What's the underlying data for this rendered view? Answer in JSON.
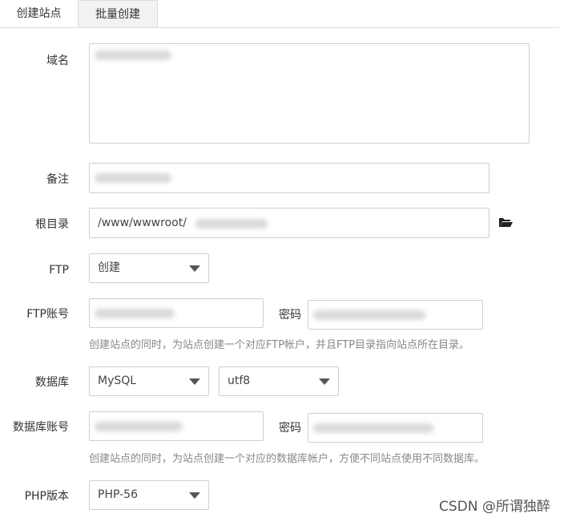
{
  "tabs": [
    {
      "label": "创建站点"
    },
    {
      "label": "批量创建"
    }
  ],
  "fields": {
    "domain_label": "域名",
    "remark_label": "备注",
    "root_label": "根目录",
    "root_value": "/www/wwwroot/",
    "ftp_label": "FTP",
    "ftp_select": "创建",
    "ftp_account_label": "FTP账号",
    "ftp_password_label": "密码",
    "ftp_help": "创建站点的同时，为站点创建一个对应FTP帐户，并且FTP目录指向站点所在目录。",
    "db_label": "数据库",
    "db_type": "MySQL",
    "db_charset": "utf8",
    "db_account_label": "数据库账号",
    "db_password_label": "密码",
    "db_help": "创建站点的同时，为站点创建一个对应的数据库帐户，方便不同站点使用不同数据库。",
    "php_label": "PHP版本",
    "php_select": "PHP-56"
  },
  "watermark": "CSDN @所谓独醉",
  "icons": {
    "folder": "folder-open-icon",
    "caret": "chevron-down-icon"
  }
}
